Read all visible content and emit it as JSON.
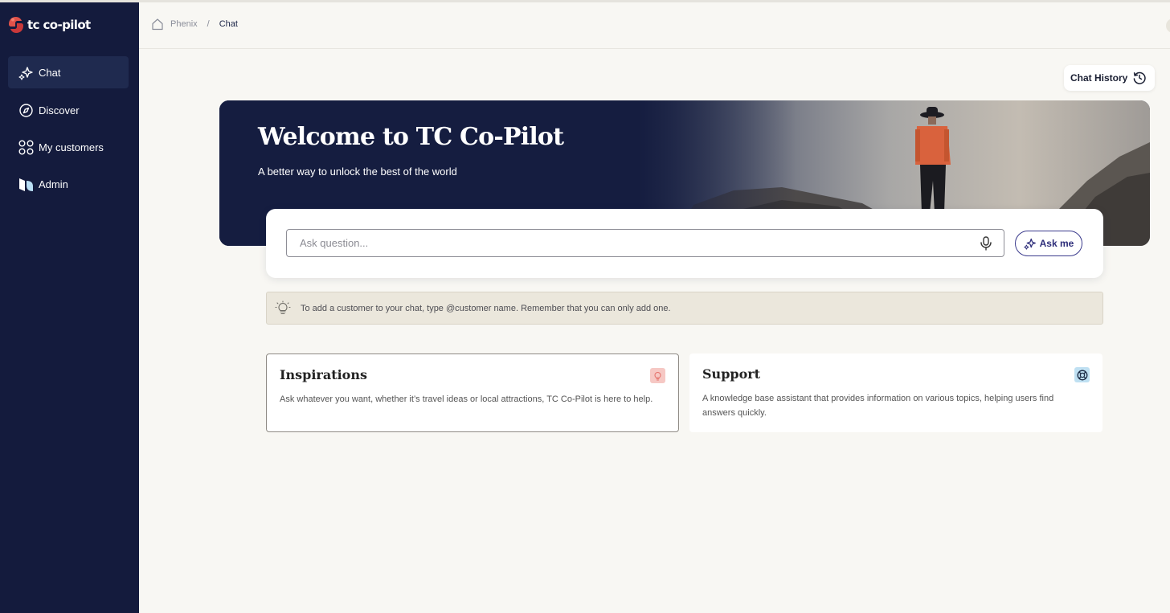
{
  "brand": {
    "name": "tc co-pilot"
  },
  "sidebar": {
    "items": [
      {
        "label": "Chat",
        "icon": "sparkle-icon",
        "active": true
      },
      {
        "label": "Discover",
        "icon": "compass-icon",
        "active": false
      },
      {
        "label": "My customers",
        "icon": "grid-circles-icon",
        "active": false
      },
      {
        "label": "Admin",
        "icon": "admin-logo-icon",
        "active": false
      }
    ]
  },
  "breadcrumb": {
    "home_icon": "home-icon",
    "root": "Phenix",
    "separator": "/",
    "current": "Chat"
  },
  "header": {
    "history_label": "Chat History",
    "history_icon": "history-clock-icon"
  },
  "hero": {
    "title": "Welcome to TC Co-Pilot",
    "subtitle": "A better way to unlock the best of the world"
  },
  "search": {
    "placeholder": "Ask question...",
    "value": "",
    "mic_icon": "microphone-icon",
    "ask_label": "Ask me",
    "ask_icon": "sparkle-icon"
  },
  "tip": {
    "icon": "lightbulb-icon",
    "text": "To add a customer to your chat, type @customer name. Remember that you can only add one."
  },
  "cards": [
    {
      "title": "Inspirations",
      "description": "Ask whatever you want, whether it’s travel ideas or local attractions, TC Co-Pilot is here to help.",
      "icon": "lightbulb-icon",
      "badge_color": "#f6c8c4"
    },
    {
      "title": "Support",
      "description": "A knowledge base assistant that provides information on various topics, helping users find answers quickly.",
      "icon": "lifebuoy-icon",
      "badge_color": "#bfe0f2"
    }
  ],
  "colors": {
    "sidebar_bg": "#141b3d",
    "active_item_bg": "#1f2a4f",
    "accent": "#2d2d7a",
    "page_bg": "#f8f7f3",
    "tip_bg": "#ebe7dc"
  }
}
